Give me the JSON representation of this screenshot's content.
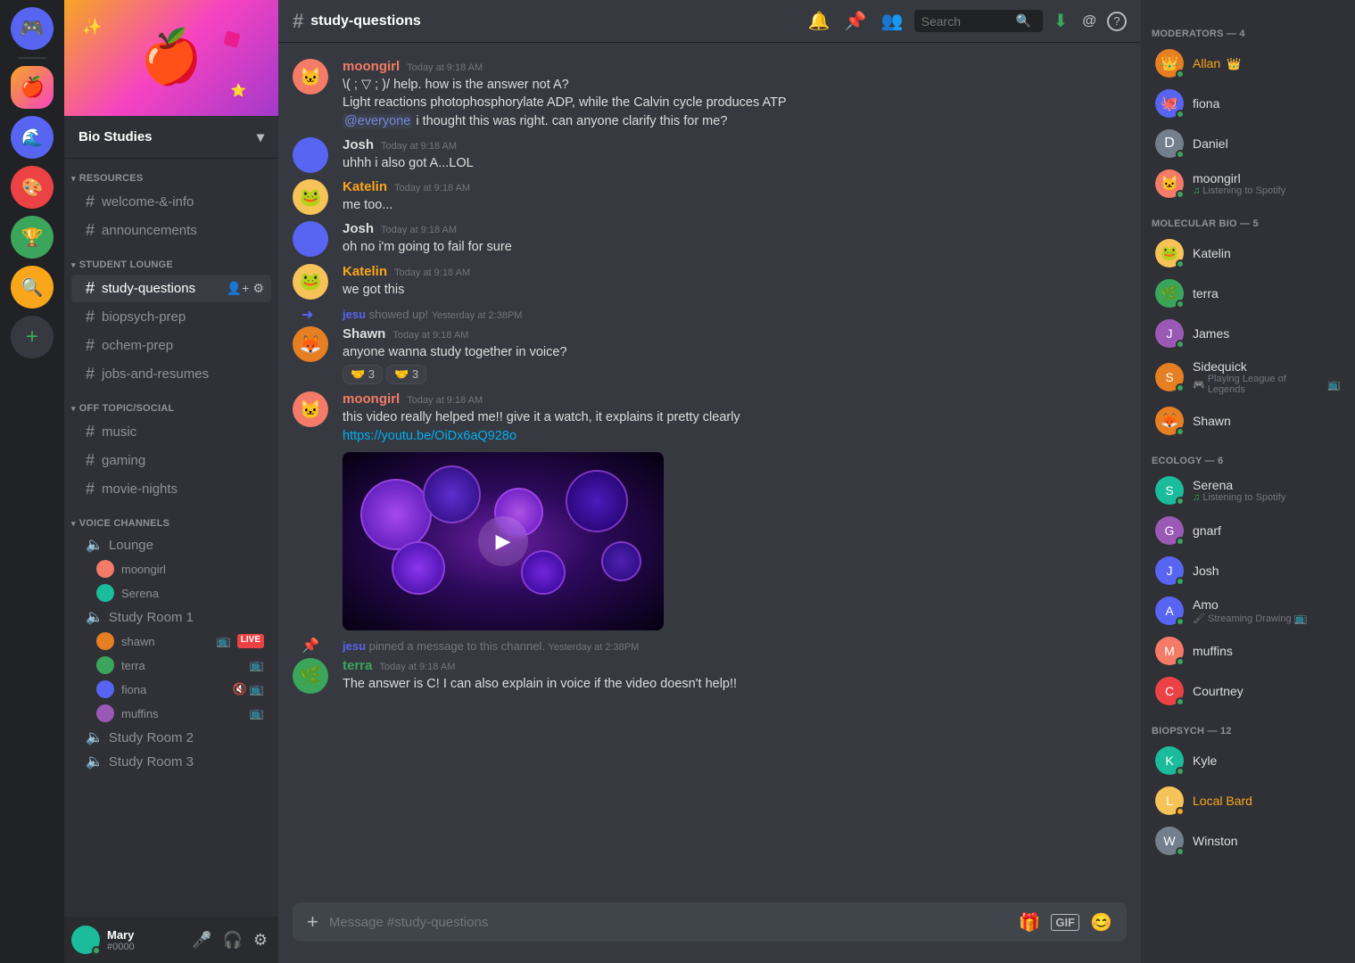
{
  "app": {
    "title": "DISCORD"
  },
  "server": {
    "name": "Bio Studies",
    "banner_color": "#7289da"
  },
  "channel": {
    "name": "study-questions",
    "placeholder": "Message #study-questions"
  },
  "categories": [
    {
      "id": "resources",
      "label": "RESOURCES",
      "channels": [
        {
          "id": "welcome-info",
          "label": "welcome-&-info"
        },
        {
          "id": "announcements",
          "label": "announcements"
        }
      ]
    },
    {
      "id": "student-lounge",
      "label": "STUDENT LOUNGE",
      "channels": [
        {
          "id": "study-questions",
          "label": "study-questions",
          "active": true
        },
        {
          "id": "biopsych-prep",
          "label": "biopsych-prep"
        },
        {
          "id": "ochem-prep",
          "label": "ochem-prep"
        },
        {
          "id": "jobs-and-resumes",
          "label": "jobs-and-resumes"
        }
      ]
    },
    {
      "id": "off-topic",
      "label": "OFF TOPIC/SOCIAL",
      "channels": [
        {
          "id": "music",
          "label": "music"
        },
        {
          "id": "gaming",
          "label": "gaming"
        },
        {
          "id": "movie-nights",
          "label": "movie-nights"
        }
      ]
    }
  ],
  "voice_channels": [
    {
      "id": "lounge",
      "label": "Lounge",
      "users": [
        {
          "name": "moongirl",
          "color": "av-pink"
        },
        {
          "name": "Serena",
          "color": "av-teal"
        }
      ]
    },
    {
      "id": "study-room-1",
      "label": "Study Room 1",
      "users": [
        {
          "name": "shawn",
          "color": "av-orange",
          "live": true,
          "stream": true
        },
        {
          "name": "terra",
          "color": "av-green",
          "stream": true
        },
        {
          "name": "fiona",
          "color": "av-blue",
          "muted": true,
          "stream": true
        },
        {
          "name": "muffins",
          "color": "av-purple",
          "stream": true
        }
      ]
    },
    {
      "id": "study-room-2",
      "label": "Study Room 2"
    },
    {
      "id": "study-room-3",
      "label": "Study Room 3"
    }
  ],
  "current_user": {
    "name": "Mary",
    "tag": "#0000",
    "color": "av-teal",
    "status": "online"
  },
  "messages": [
    {
      "id": 1,
      "author": "moongirl",
      "author_color": "#f47b67",
      "avatar_color": "av-pink",
      "timestamp": "Today at 9:18 AM",
      "lines": [
        "\\( ; ▽ ; )/ help. how is the answer not A?",
        "Light reactions photophosphorylate ADP, while the Calvin cycle produces ATP",
        "@everyone i thought this was right. can anyone clarify this for me?"
      ],
      "has_mention": true,
      "mention_text": "@everyone"
    },
    {
      "id": 2,
      "author": "Josh",
      "author_color": "#dcddde",
      "avatar_color": "av-blue",
      "timestamp": "Today at 9:18 AM",
      "lines": [
        "uhhh i also got A...LOL"
      ]
    },
    {
      "id": 3,
      "author": "Katelin",
      "author_color": "#faa61a",
      "avatar_color": "av-yellow",
      "timestamp": "Today at 9:18 AM",
      "lines": [
        "me too..."
      ]
    },
    {
      "id": 4,
      "author": "Josh",
      "author_color": "#dcddde",
      "avatar_color": "av-blue",
      "timestamp": "Today at 9:18 AM",
      "lines": [
        "oh no i'm going to fail for sure"
      ]
    },
    {
      "id": 5,
      "author": "Katelin",
      "author_color": "#faa61a",
      "avatar_color": "av-yellow",
      "timestamp": "Today at 9:18 AM",
      "lines": [
        "we got this"
      ]
    },
    {
      "id": 6,
      "system": true,
      "text_before": "jesu",
      "text_mid": "showed up!",
      "timestamp": "Yesterday at 2:38PM"
    },
    {
      "id": 7,
      "author": "Shawn",
      "author_color": "#dcddde",
      "avatar_color": "av-orange",
      "timestamp": "Today at 9:18 AM",
      "lines": [
        "anyone wanna study together in voice?"
      ],
      "reactions": [
        {
          "emoji": "🤝",
          "count": 3
        },
        {
          "emoji": "🤝",
          "count": 3
        }
      ]
    },
    {
      "id": 8,
      "author": "moongirl",
      "author_color": "#f47b67",
      "avatar_color": "av-pink",
      "timestamp": "Today at 9:18 AM",
      "lines": [
        "this video really helped me!! give it a watch, it explains it pretty clearly",
        "https://youtu.be/OiDx6aQ928o"
      ],
      "has_link": true,
      "link_text": "https://youtu.be/OiDx6aQ928o",
      "has_video": true
    },
    {
      "id": 9,
      "system": true,
      "text_before": "jesu",
      "text_mid": "pinned a message to this channel.",
      "timestamp": "Yesterday at 2:38PM"
    },
    {
      "id": 10,
      "author": "terra",
      "author_color": "#3ba55c",
      "avatar_color": "av-green",
      "timestamp": "Today at 9:18 AM",
      "lines": [
        "The answer is C! I can also explain in voice if the video doesn't help!!"
      ]
    }
  ],
  "members": {
    "moderators": {
      "label": "MODERATORS — 4",
      "members": [
        {
          "name": "Allan",
          "color": "av-orange",
          "crown": true,
          "status": "online"
        },
        {
          "name": "fiona",
          "color": "av-blue",
          "status": "online"
        },
        {
          "name": "Daniel",
          "color": "av-grey",
          "status": "online"
        },
        {
          "name": "moongirl",
          "color": "av-pink",
          "status": "online",
          "activity": "Listening to Spotify",
          "activity_type": "spotify"
        }
      ]
    },
    "molecular_bio": {
      "label": "MOLECULAR BIO — 5",
      "members": [
        {
          "name": "Katelin",
          "color": "av-yellow",
          "status": "online"
        },
        {
          "name": "terra",
          "color": "av-green",
          "status": "online"
        },
        {
          "name": "James",
          "color": "av-purple",
          "status": "online"
        },
        {
          "name": "Sidequick",
          "color": "av-orange",
          "status": "online",
          "activity": "Playing League of Legends",
          "activity_type": "league",
          "stream": true
        },
        {
          "name": "Shawn",
          "color": "av-orange",
          "status": "online"
        }
      ]
    },
    "ecology": {
      "label": "ECOLOGY — 6",
      "members": [
        {
          "name": "Serena",
          "color": "av-teal",
          "status": "online",
          "activity": "Listening to Spotify",
          "activity_type": "spotify"
        },
        {
          "name": "gnarf",
          "color": "av-purple",
          "status": "online"
        },
        {
          "name": "Josh",
          "color": "av-blue",
          "status": "online"
        },
        {
          "name": "Amo",
          "color": "av-blue",
          "status": "online",
          "activity": "Streaming Drawing",
          "activity_type": "stream"
        },
        {
          "name": "muffins",
          "color": "av-pink",
          "status": "online"
        },
        {
          "name": "Courtney",
          "color": "av-red",
          "status": "online"
        }
      ]
    },
    "biopsych": {
      "label": "BIOPSYCH — 12",
      "members": [
        {
          "name": "Kyle",
          "color": "av-teal",
          "status": "online"
        },
        {
          "name": "Local Bard",
          "color": "av-yellow",
          "status": "idle"
        },
        {
          "name": "Winston",
          "color": "av-grey",
          "status": "online"
        }
      ]
    }
  },
  "search": {
    "placeholder": "Search"
  },
  "header_icons": {
    "bell": "🔔",
    "pin": "📌",
    "members": "👥",
    "search": "🔍",
    "inbox": "📥",
    "mention": "@",
    "help": "?"
  }
}
